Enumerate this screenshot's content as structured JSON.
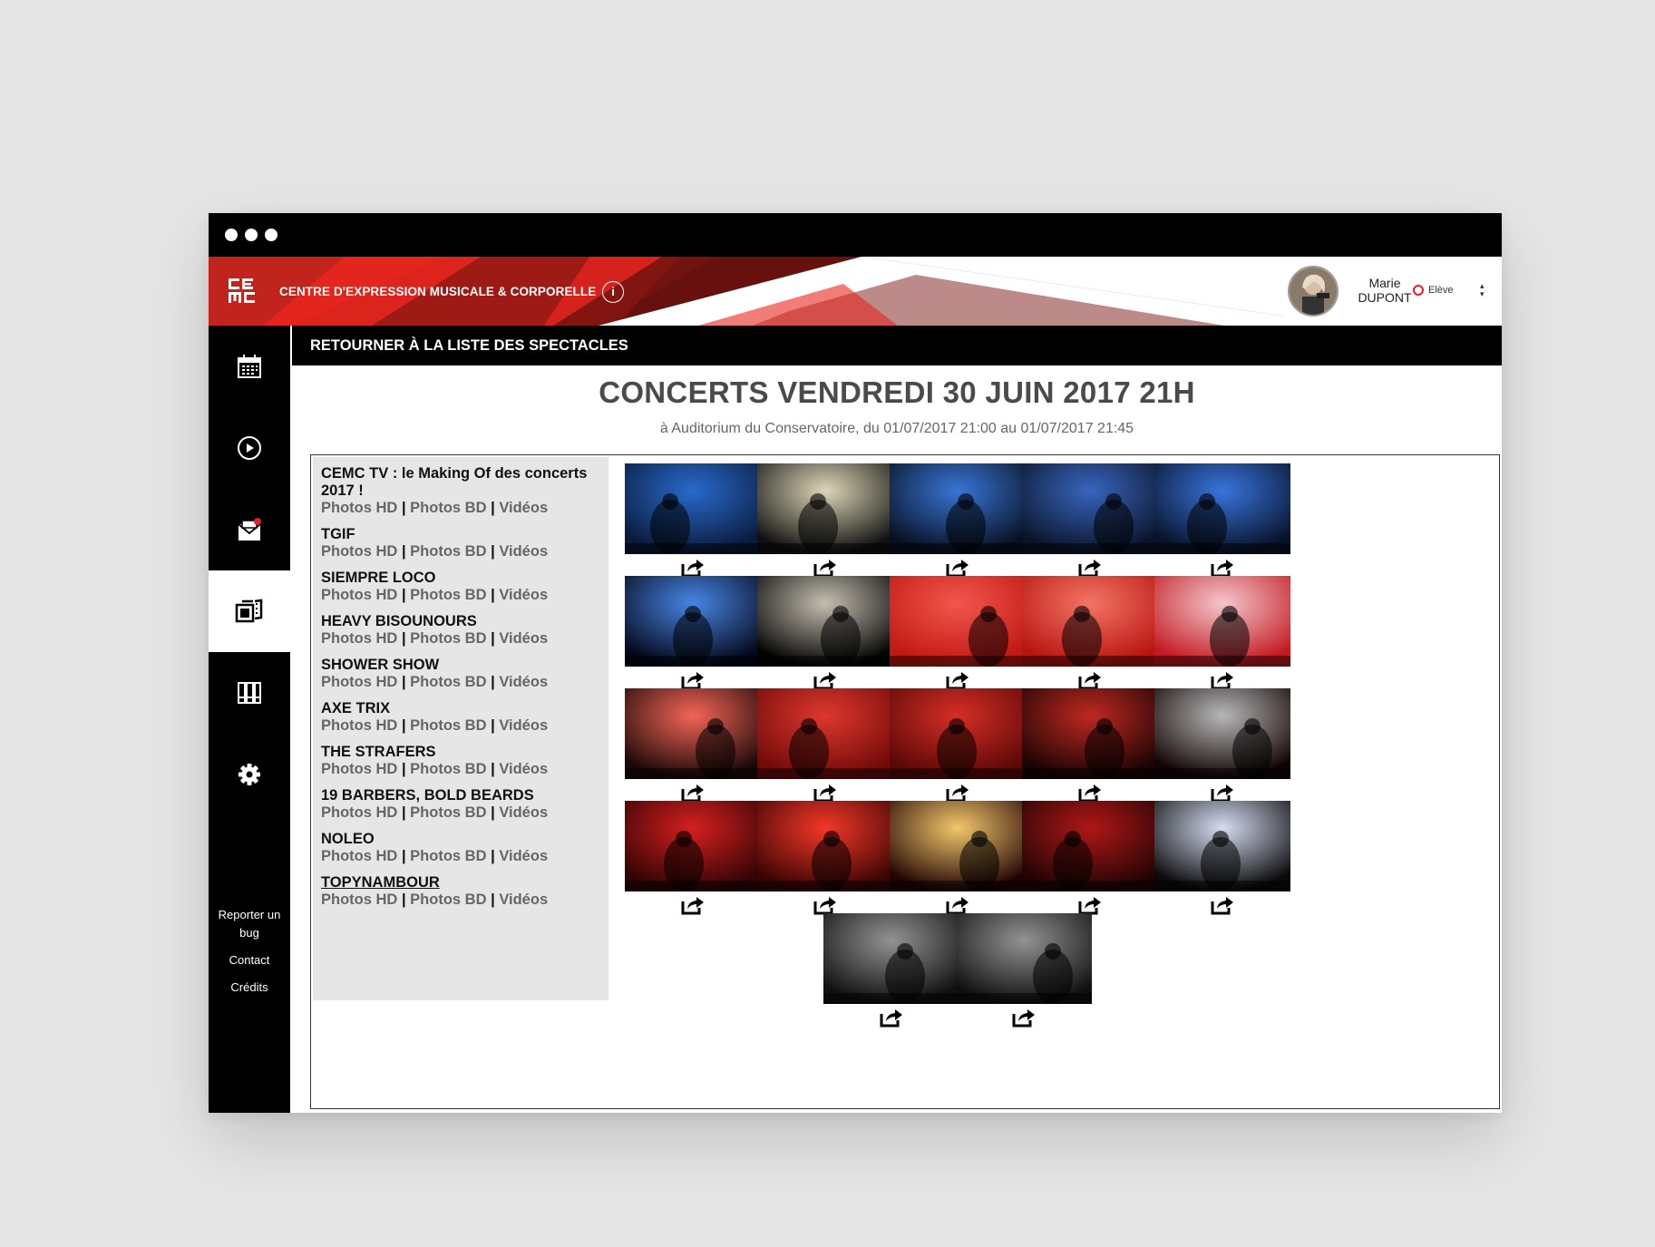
{
  "header": {
    "org_name": "CENTRE D'EXPRESSION MUSICALE & CORPORELLE",
    "info_label": "i",
    "user": {
      "first_name": "Marie",
      "last_name": "DUPONT",
      "role": "Elève"
    }
  },
  "back_link": "RETOURNER À LA LISTE DES SPECTACLES",
  "event": {
    "title": "CONCERTS VENDREDI 30 JUIN 2017 21H",
    "subtitle": "à Auditorium du Conservatoire, du 01/07/2017 21:00 au 01/07/2017 21:45"
  },
  "sidebar": {
    "links": [
      "Reporter un bug",
      "Contact",
      "Crédits"
    ]
  },
  "media_links": {
    "hd": "Photos HD",
    "bd": "Photos BD",
    "videos": "Vidéos",
    "separator": "|"
  },
  "bands": [
    {
      "name": "CEMC TV : le Making Of des concerts 2017 !"
    },
    {
      "name": "TGIF"
    },
    {
      "name": "SIEMPRE LOCO"
    },
    {
      "name": "HEAVY BISOUNOURS"
    },
    {
      "name": "SHOWER SHOW"
    },
    {
      "name": "AXE TRIX"
    },
    {
      "name": "THE STRAFERS"
    },
    {
      "name": "19 BARBERS, BOLD BEARDS"
    },
    {
      "name": "NOLEO"
    },
    {
      "name": "TOPYNAMBOUR"
    }
  ],
  "colors": {
    "brand_red": "#e31e24",
    "dark_red": "#7a1511",
    "black": "#000000"
  }
}
